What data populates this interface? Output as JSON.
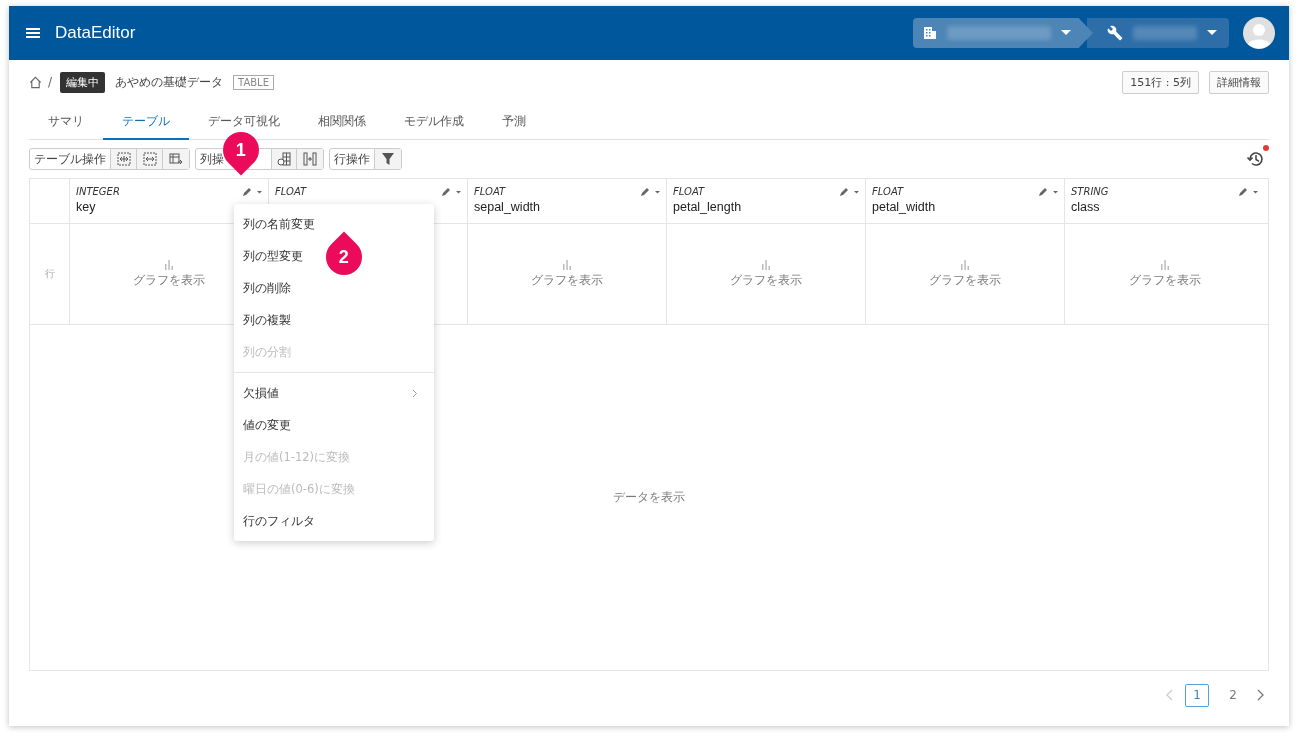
{
  "app": {
    "title": "DataEditor"
  },
  "breadcrumb": {
    "separator": "/",
    "status": "編集中",
    "name": "あやめの基礎データ",
    "tag": "TABLE"
  },
  "info_buttons": [
    "151行 : 5列",
    "詳細情報"
  ],
  "tabs": [
    {
      "label": "サマリ",
      "selected": false
    },
    {
      "label": "テーブル",
      "selected": true
    },
    {
      "label": "データ可視化",
      "selected": false
    },
    {
      "label": "相関関係",
      "selected": false
    },
    {
      "label": "モデル作成",
      "selected": false
    },
    {
      "label": "予測",
      "selected": false
    }
  ],
  "toolbar": {
    "table_ops": "テーブル操作",
    "column_ops": "列操",
    "row_ops": "行操作"
  },
  "history": {
    "notification": true
  },
  "table": {
    "row_header": "行",
    "columns": [
      {
        "type": "INTEGER",
        "name": "key",
        "graph": "グラフを表示"
      },
      {
        "type": "FLOAT"
      },
      {
        "type": "FLOAT",
        "name": "sepal_width",
        "graph": "グラフを表示"
      },
      {
        "type": "FLOAT",
        "name": "petal_length",
        "graph": "グラフを表示"
      },
      {
        "type": "FLOAT",
        "name": "petal_width",
        "graph": "グラフを表示"
      },
      {
        "type": "STRING",
        "name": "class",
        "graph": "グラフを表示"
      }
    ],
    "body_placeholder": "データを表示"
  },
  "menu": {
    "items": [
      {
        "label": "列の名前変更",
        "disabled": false,
        "kind": "item"
      },
      {
        "label": "列の型変更",
        "disabled": false,
        "kind": "item"
      },
      {
        "label": "列の削除",
        "disabled": false,
        "kind": "item"
      },
      {
        "label": "列の複製",
        "disabled": false,
        "kind": "item"
      },
      {
        "label": "列の分割",
        "disabled": true,
        "kind": "item"
      },
      {
        "kind": "divider"
      },
      {
        "label": "欠損値",
        "disabled": false,
        "kind": "submenu"
      },
      {
        "label": "値の変更",
        "disabled": false,
        "kind": "item"
      },
      {
        "label": "月の値(1-12)に変換",
        "disabled": true,
        "kind": "item"
      },
      {
        "label": "曜日の値(0-6)に変換",
        "disabled": true,
        "kind": "item"
      },
      {
        "label": "行のフィルタ",
        "disabled": false,
        "kind": "item"
      }
    ]
  },
  "callouts": [
    "1",
    "2"
  ],
  "pagination": [
    {
      "label": "1",
      "selected": true
    },
    {
      "label": "2",
      "selected": false
    }
  ]
}
